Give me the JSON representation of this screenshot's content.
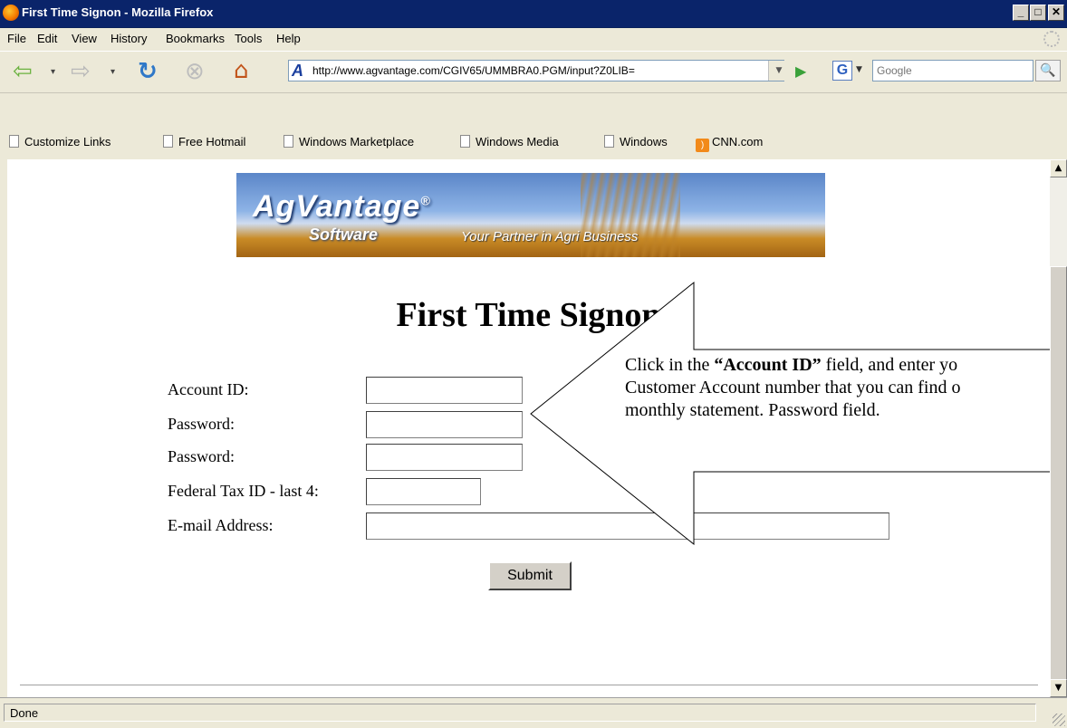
{
  "window": {
    "title": "First Time Signon - Mozilla Firefox",
    "minimize": "_",
    "maximize": "□",
    "close": "✕"
  },
  "menu": {
    "items": [
      "File",
      "Edit",
      "View",
      "History",
      "Bookmarks",
      "Tools",
      "Help"
    ]
  },
  "toolbar": {
    "url": "http://www.agvantage.com/CGIV65/UMMBRA0.PGM/input?Z0LIB=",
    "site_icon": "A",
    "search_engine": "G",
    "search_placeholder": "Google"
  },
  "bookmarks": {
    "items": [
      "Customize Links",
      "Free Hotmail",
      "Windows Marketplace",
      "Windows Media",
      "Windows",
      "CNN.com"
    ]
  },
  "banner": {
    "brand": "AgVantage",
    "registered": "®",
    "sub": "Software",
    "tagline": "Your Partner in Agri Business"
  },
  "page": {
    "title": "First Time Signon",
    "fields": [
      {
        "label": "Account ID:",
        "value": ""
      },
      {
        "label": "Password:",
        "value": ""
      },
      {
        "label": "Password:",
        "value": ""
      },
      {
        "label": "Federal Tax ID - last 4:",
        "value": ""
      },
      {
        "label": "E-mail Address:",
        "value": ""
      }
    ],
    "submit_label": "Submit"
  },
  "callout": {
    "line1_prefix": "Click in the ",
    "line1_bold": "“Account ID”",
    "line1_suffix": " field, and enter yo",
    "line2": "Customer Account number that you can find o",
    "line3": "monthly statement.  Password field."
  },
  "status": {
    "text": "Done"
  },
  "colors": {
    "title_bar": "#0a246a",
    "chrome": "#ece9d8",
    "link_icon": "#f28a1a"
  }
}
